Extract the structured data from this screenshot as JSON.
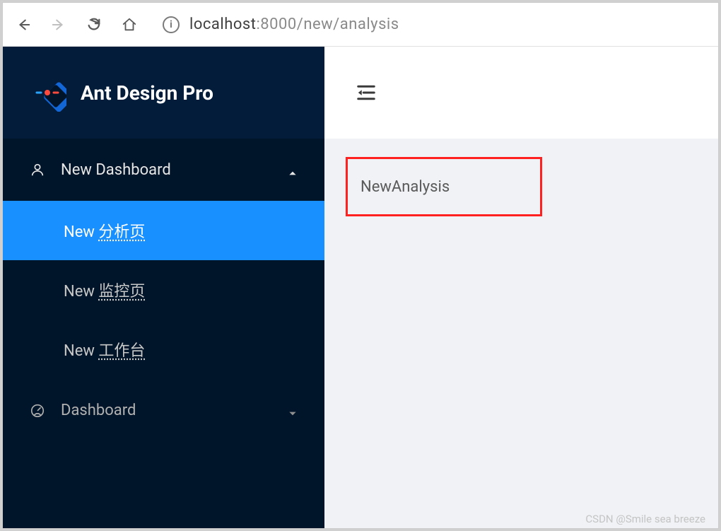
{
  "browser": {
    "url_host": "localhost",
    "url_port_path": ":8000/new/analysis"
  },
  "sidebar": {
    "title": "Ant Design Pro",
    "groups": [
      {
        "label": "New Dashboard",
        "expanded": true,
        "items": [
          {
            "label_en": "New",
            "label_cn": "分析页",
            "active": true
          },
          {
            "label_en": "New",
            "label_cn": "监控页",
            "active": false
          },
          {
            "label_en": "New",
            "label_cn": "工作台",
            "active": false
          }
        ]
      },
      {
        "label": "Dashboard",
        "expanded": false
      }
    ]
  },
  "content": {
    "heading": "NewAnalysis"
  },
  "watermark": "CSDN @Smile sea breeze"
}
